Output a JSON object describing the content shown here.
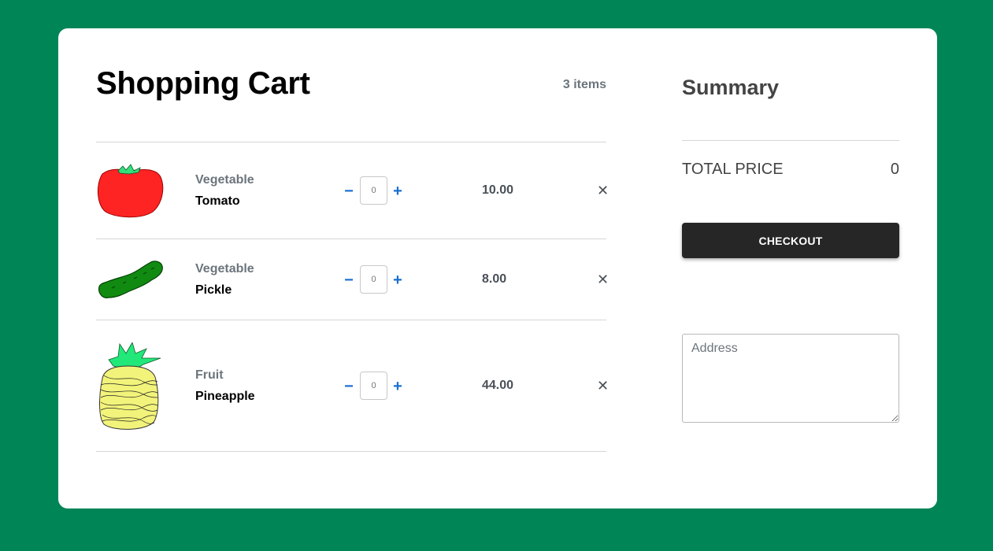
{
  "cart": {
    "title": "Shopping Cart",
    "items_count": "3 items",
    "items": [
      {
        "category": "Vegetable",
        "name": "Tomato",
        "quantity": "0",
        "price": "10.00",
        "remove": "✕",
        "icon": "tomato-image"
      },
      {
        "category": "Vegetable",
        "name": "Pickle",
        "quantity": "0",
        "price": "8.00",
        "remove": "✕",
        "icon": "pickle-image"
      },
      {
        "category": "Fruit",
        "name": "Pineapple",
        "quantity": "0",
        "price": "44.00",
        "remove": "✕",
        "icon": "pineapple-image"
      }
    ],
    "minus_label": "−",
    "plus_label": "+"
  },
  "summary": {
    "title": "Summary",
    "total_label": "TOTAL PRICE",
    "total_value": "0",
    "checkout_label": "CHECKOUT",
    "address_placeholder": "Address"
  },
  "colors": {
    "background": "#008557",
    "checkout_button": "#262626",
    "stepper_accent": "#1a6fd1"
  }
}
